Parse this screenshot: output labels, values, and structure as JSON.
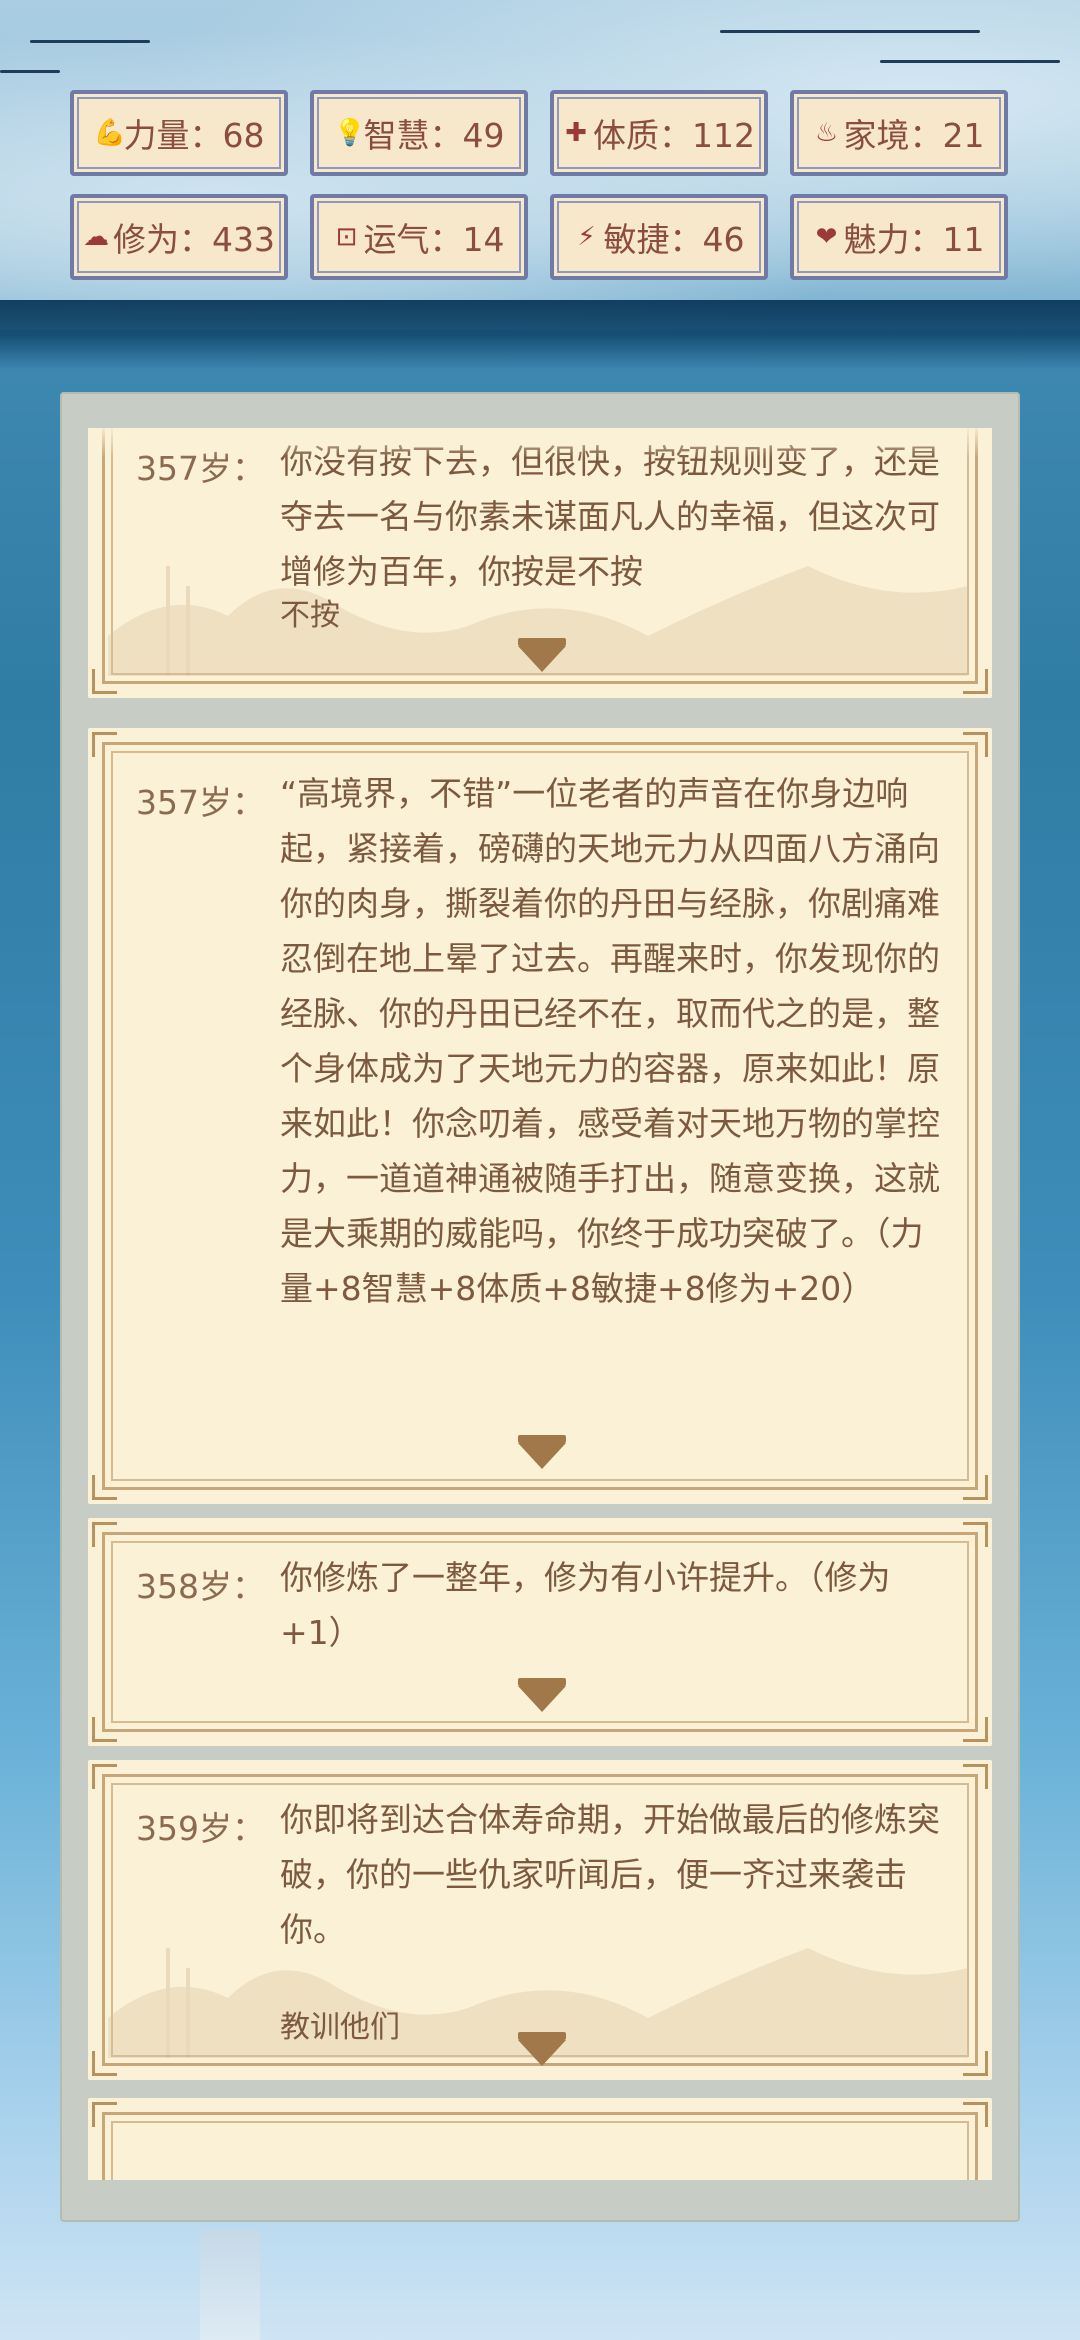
{
  "stats": [
    {
      "icon": "strength-icon",
      "glyph": "💪",
      "label": "力量：68"
    },
    {
      "icon": "wisdom-icon",
      "glyph": "💡",
      "label": "智慧：49"
    },
    {
      "icon": "constitution-icon",
      "glyph": "✚",
      "label": "体质：112"
    },
    {
      "icon": "family-icon",
      "glyph": "♨",
      "label": "家境：21"
    },
    {
      "icon": "cultivation-icon",
      "glyph": "☁",
      "label": "修为：433"
    },
    {
      "icon": "luck-icon",
      "glyph": "⊡",
      "label": "运气：14"
    },
    {
      "icon": "agility-icon",
      "glyph": "⚡",
      "label": "敏捷：46"
    },
    {
      "icon": "charm-icon",
      "glyph": "❤",
      "label": "魅力：11"
    }
  ],
  "events": [
    {
      "age": "357岁：",
      "text": "你没有按下去，但很快，按钮规则变了，还是夺去一名与你素未谋面凡人的幸福，但这次可增修为百年，你按是不按",
      "choice": "不按"
    },
    {
      "age": "357岁：",
      "text": "“高境界，不错”一位老者的声音在你身边响起，紧接着，磅礴的天地元力从四面八方涌向你的肉身，撕裂着你的丹田与经脉，你剧痛难忍倒在地上晕了过去。再醒来时，你发现你的经脉、你的丹田已经不在，取而代之的是，整个身体成为了天地元力的容器，原来如此！原来如此！你念叨着，感受着对天地万物的掌控力，一道道神通被随手打出，随意变换，这就是大乘期的威能吗，你终于成功突破了。（力量+8智慧+8体质+8敏捷+8修为+20）",
      "choice": ""
    },
    {
      "age": "358岁：",
      "text": "你修炼了一整年，修为有小许提升。（修为+1）",
      "choice": ""
    },
    {
      "age": "359岁：",
      "text": "你即将到达合体寿命期，开始做最后的修炼突破，你的一些仇家听闻后，便一齐过来袭击你。",
      "choice": "教训他们"
    }
  ]
}
